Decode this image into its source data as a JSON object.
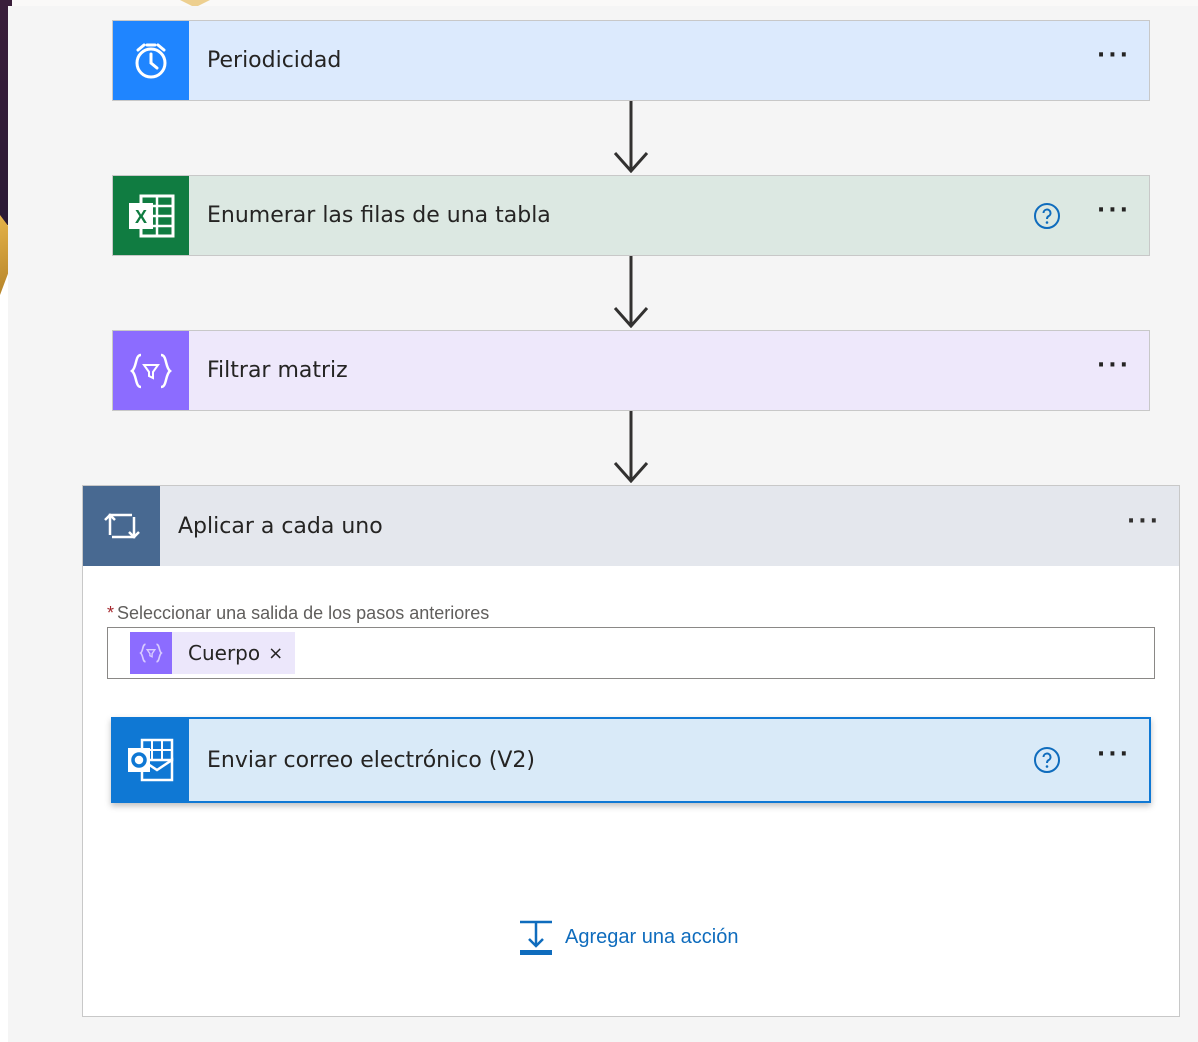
{
  "steps": [
    {
      "title": "Periodicidad",
      "icon": "alarm-clock-icon",
      "color": "#1f85ff",
      "bg": "#dceafd"
    },
    {
      "title": "Enumerar las filas de una tabla",
      "icon": "excel-icon",
      "color": "#107c41",
      "bg": "#dce8e2",
      "help": true
    },
    {
      "title": "Filtrar matriz",
      "icon": "filter-array-icon",
      "color": "#8c6cff",
      "bg": "#eee8fb"
    }
  ],
  "loop": {
    "title": "Aplicar a cada uno",
    "icon": "loop-icon",
    "color": "#486991",
    "field_required_mark": "*",
    "field_label": "Seleccionar una salida de los pasos anteriores",
    "token": {
      "label": "Cuerpo",
      "remove": "×"
    },
    "inner_action": {
      "title": "Enviar correo electrónico (V2)",
      "icon": "outlook-icon",
      "color": "#0f78d4",
      "bg": "#d9eaf8"
    },
    "add_action_label": "Agregar una acción"
  },
  "more_label": "···"
}
